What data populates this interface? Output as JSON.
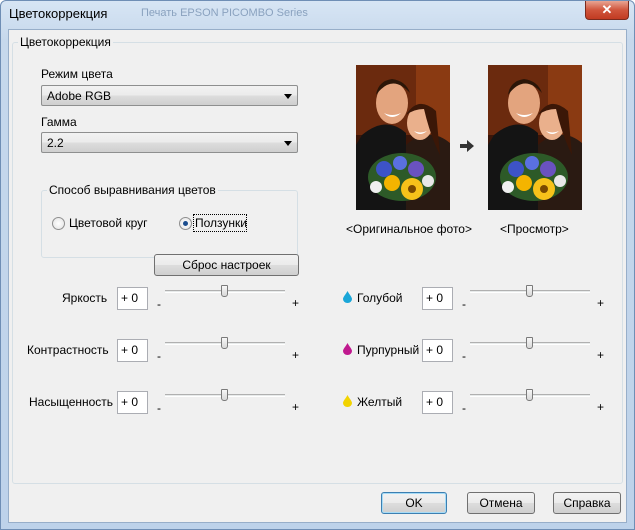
{
  "window": {
    "title": "Цветокоррекция",
    "ghost_title": "Печать EPSON PICOMBO Series"
  },
  "group": {
    "title": "Цветокоррекция"
  },
  "color_mode": {
    "label": "Режим цвета",
    "value": "Adobe RGB"
  },
  "gamma": {
    "label": "Гамма",
    "value": "2.2"
  },
  "alignment": {
    "title": "Способ выравнивания цветов",
    "options": [
      "Цветовой круг",
      "Ползунки"
    ],
    "selected": "Ползунки"
  },
  "preview": {
    "original_caption": "<Оригинальное фото>",
    "preview_caption": "<Просмотр>"
  },
  "reset_button": "Сброс настроек",
  "sliders_left": [
    {
      "label": "Яркость",
      "value": "+ 0",
      "level": 0.5
    },
    {
      "label": "Контрастность",
      "value": "+ 0",
      "level": 0.5
    },
    {
      "label": "Насыщенность",
      "value": "+ 0",
      "level": 0.5
    }
  ],
  "sliders_right": [
    {
      "label": "Голубой",
      "value": "+ 0",
      "level": 0.5,
      "icon": "cyan-drop-icon",
      "color": "#1aa6d8"
    },
    {
      "label": "Пурпурный",
      "value": "+ 0",
      "level": 0.5,
      "icon": "magenta-drop-icon",
      "color": "#c0198f"
    },
    {
      "label": "Желтый",
      "value": "+ 0",
      "level": 0.5,
      "icon": "yellow-drop-icon",
      "color": "#f2d300"
    }
  ],
  "scale": {
    "minus": "-",
    "plus": "+"
  },
  "buttons": {
    "ok": "OK",
    "cancel": "Отмена",
    "help": "Справка"
  }
}
